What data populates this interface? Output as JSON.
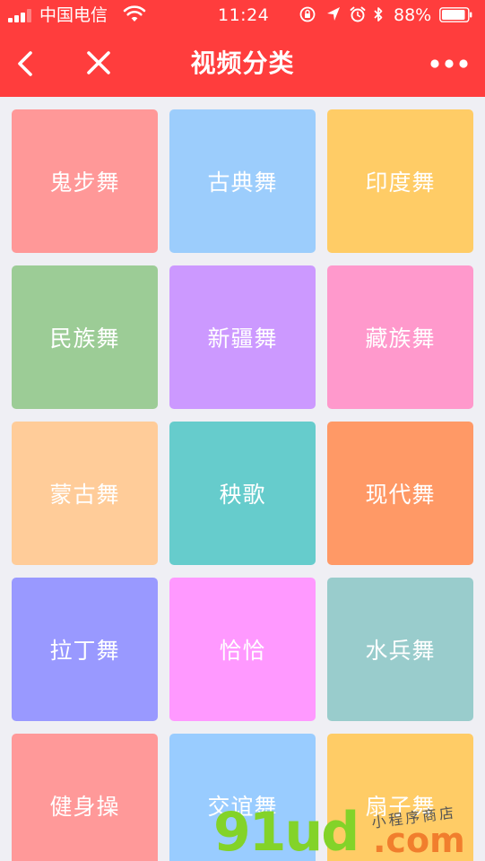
{
  "status_bar": {
    "carrier": "中国电信",
    "time": "11:24",
    "battery": "88%",
    "icons": [
      "signal-icon",
      "wifi-icon",
      "orientation-lock-icon",
      "location-icon",
      "alarm-icon",
      "bluetooth-icon",
      "battery-icon"
    ]
  },
  "header": {
    "title": "视频分类",
    "background": "#ff3d3d",
    "icons": [
      "back-icon",
      "close-icon",
      "more-icon"
    ]
  },
  "categories": [
    {
      "label": "鬼步舞",
      "color": "#ff9898"
    },
    {
      "label": "古典舞",
      "color": "#9ccdfc"
    },
    {
      "label": "印度舞",
      "color": "#ffcc66"
    },
    {
      "label": "民族舞",
      "color": "#9ccc96"
    },
    {
      "label": "新疆舞",
      "color": "#cc99ff"
    },
    {
      "label": "藏族舞",
      "color": "#ff99cc"
    },
    {
      "label": "蒙古舞",
      "color": "#ffcc99"
    },
    {
      "label": "秧歌",
      "color": "#66cccc"
    },
    {
      "label": "现代舞",
      "color": "#ff9966"
    },
    {
      "label": "拉丁舞",
      "color": "#9999ff"
    },
    {
      "label": "恰恰",
      "color": "#ff99ff"
    },
    {
      "label": "水兵舞",
      "color": "#99cccc"
    },
    {
      "label": "健身操",
      "color": "#ff9999"
    },
    {
      "label": "交谊舞",
      "color": "#99ccff"
    },
    {
      "label": "扇子舞",
      "color": "#ffcc66"
    }
  ],
  "watermark": {
    "logo": "91ud",
    "suffix": ".com",
    "note": "小程序商店"
  }
}
